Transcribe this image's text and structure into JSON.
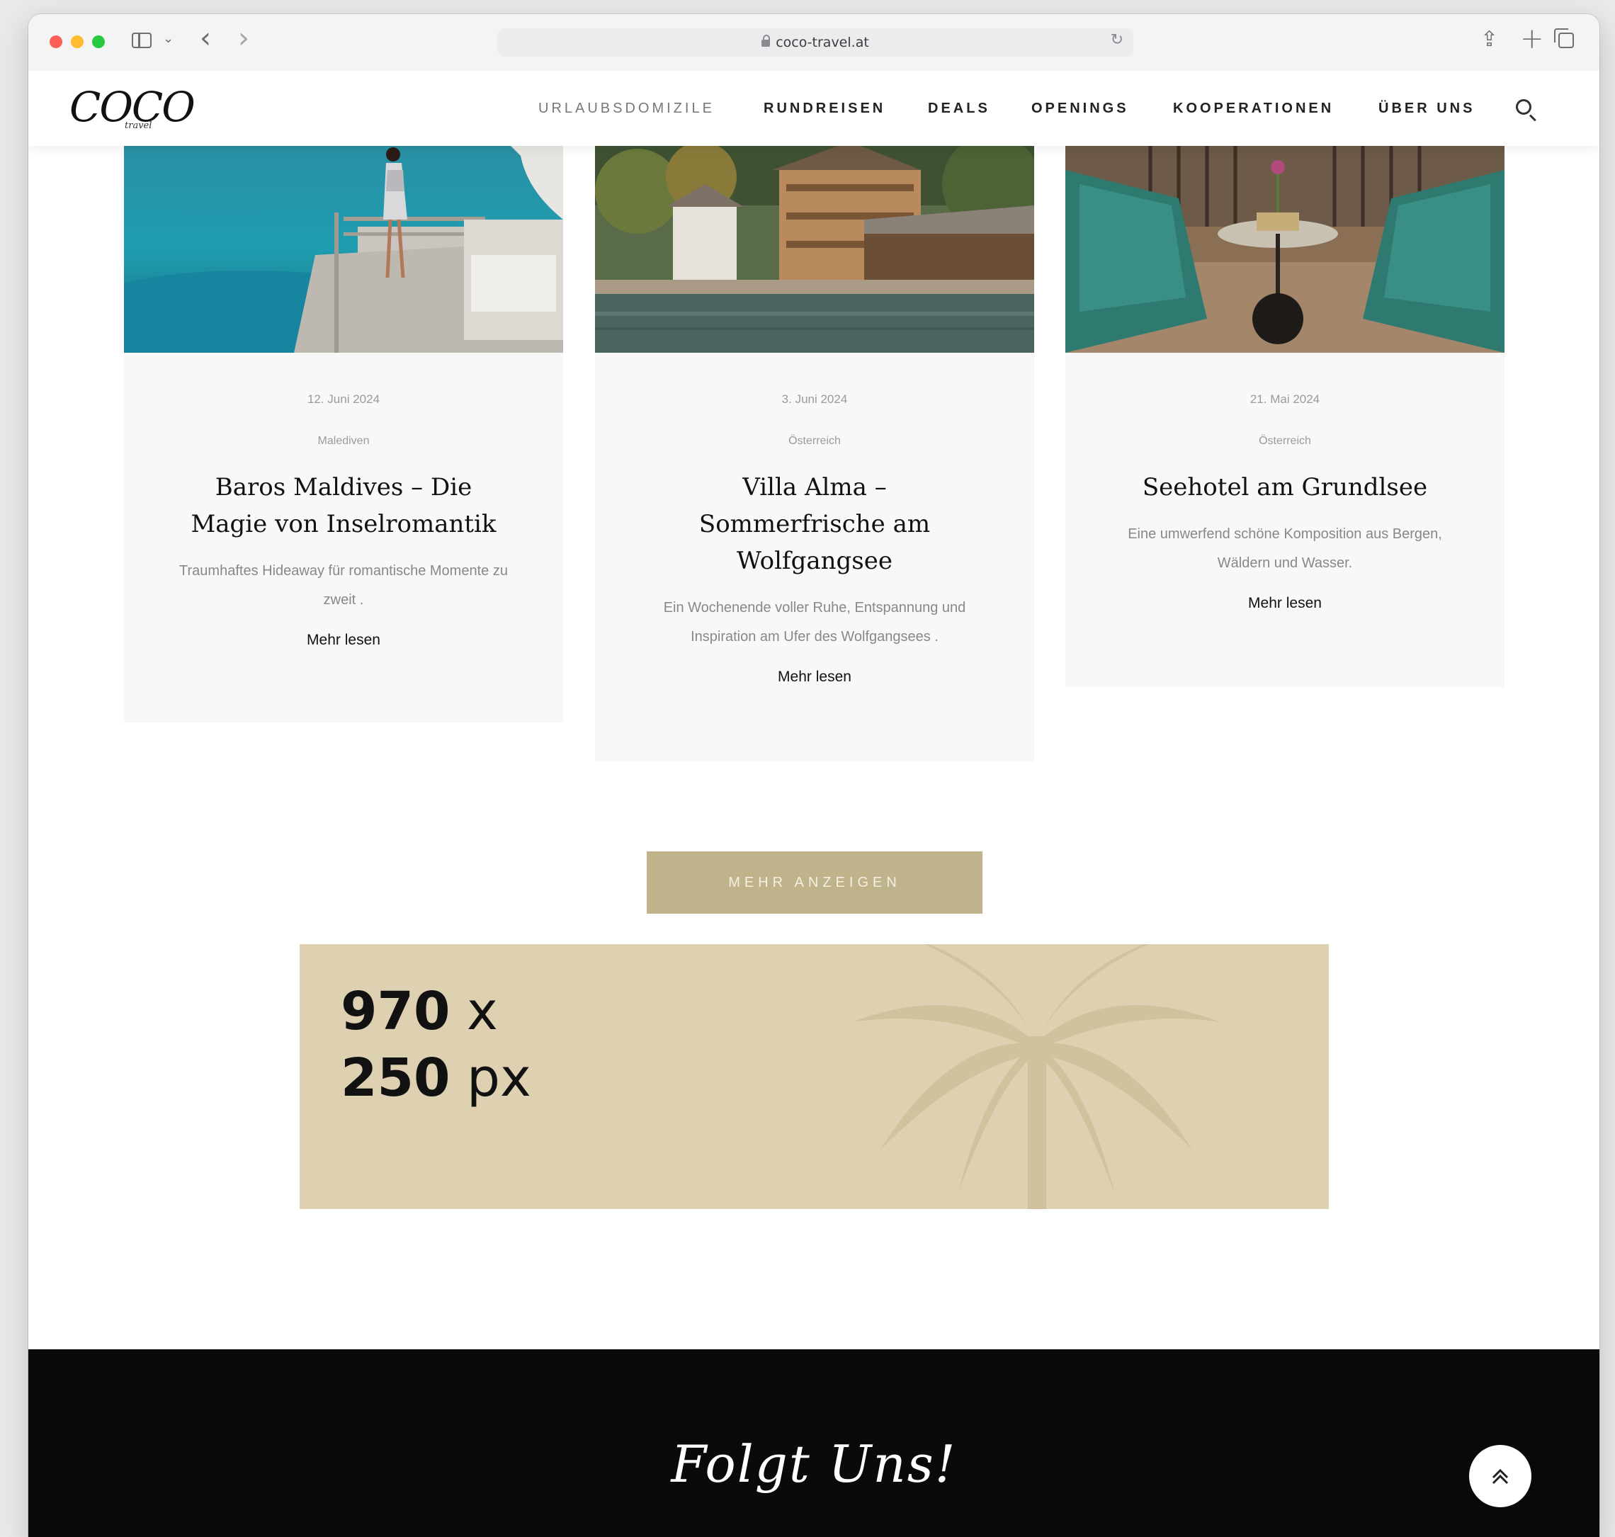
{
  "browser": {
    "url": "coco-travel.at"
  },
  "header": {
    "logo_text": "COCO",
    "logo_sub": "travel",
    "nav": [
      "URLAUBSDOMIZILE",
      "RUNDREISEN",
      "DEALS",
      "OPENINGS",
      "KOOPERATIONEN",
      "ÜBER UNS"
    ]
  },
  "cards": [
    {
      "date": "12. Juni 2024",
      "category": "Malediven",
      "title": "Baros Maldives – Die Magie von Inselromantik",
      "excerpt": "Traumhaftes Hideaway für romantische Momente zu zweit .",
      "link": "Mehr lesen"
    },
    {
      "date": "3. Juni 2024",
      "category": "Österreich",
      "title": "Villa Alma – Sommerfrische am Wolfgangsee",
      "excerpt": "Ein Wochenende voller Ruhe, Entspannung und Inspiration am Ufer des Wolfgangsees .",
      "link": "Mehr lesen"
    },
    {
      "date": "21. Mai 2024",
      "category": "Österreich",
      "title": "Seehotel am Grundlsee",
      "excerpt": "Eine umwerfend schöne Komposition aus Bergen, Wäldern und Wasser.",
      "link": "Mehr lesen"
    }
  ],
  "more_button": "MEHR ANZEIGEN",
  "ad": {
    "width_num": "970",
    "width_unit": "x",
    "height_num": "250",
    "height_unit": "px"
  },
  "footer": {
    "title": "Folgt Uns!"
  },
  "colors": {
    "accent": "#bfb38c",
    "ad_background": "#ddd1b2",
    "footer_background": "#0a0a0a"
  },
  "icons": [
    "sidebar-icon",
    "chevron-down-icon",
    "back-icon",
    "forward-icon",
    "lock-icon",
    "reload-icon",
    "share-icon",
    "new-tab-icon",
    "tabs-overview-icon",
    "search-icon",
    "palm-tree-icon",
    "arrow-up-icon"
  ]
}
